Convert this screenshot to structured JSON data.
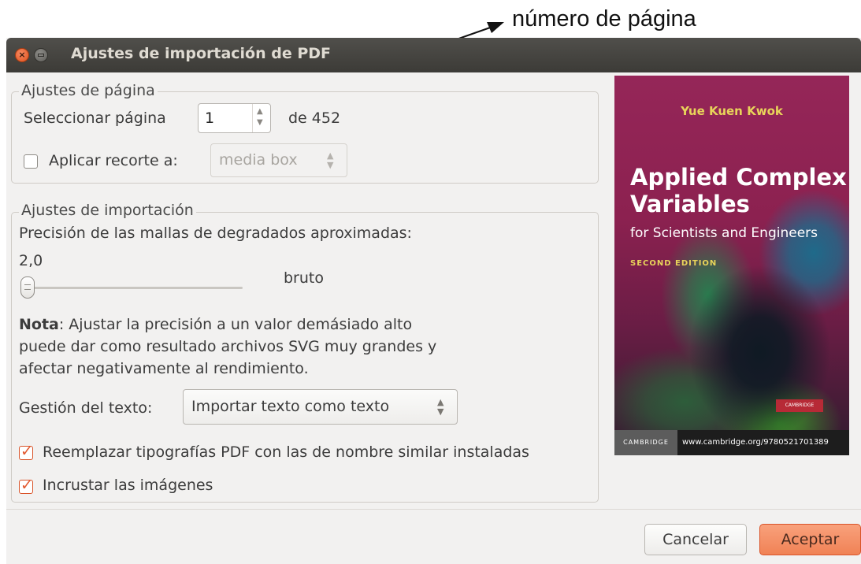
{
  "annotation": {
    "label": "número de página"
  },
  "window": {
    "title": "Ajustes de importación de PDF",
    "close_glyph": "×"
  },
  "page_settings": {
    "legend": "Ajustes de página",
    "select_page_label": "Seleccionar página",
    "page_value": "1",
    "page_of": "de 452",
    "crop_checkbox_checked": false,
    "crop_label": "Aplicar recorte a:",
    "crop_option": "media box"
  },
  "import_settings": {
    "legend": "Ajustes de importación",
    "precision_label": "Precisión de las mallas de degradados aproximadas:",
    "precision_value": "2,0",
    "precision_level_text": "bruto",
    "note_bold": "Nota",
    "note_text": ": Ajustar la precisión a un valor demásiado alto puede dar como resultado archivos SVG muy grandes y afectar negativamente al rendimiento.",
    "text_handling_label": "Gestión del texto:",
    "text_handling_option": "Importar texto como texto",
    "replace_fonts_checked": true,
    "replace_fonts_label": "Reemplazar tipografías PDF con las de nombre similar instaladas",
    "embed_images_checked": true,
    "embed_images_label": "Incrustar las imágenes"
  },
  "preview": {
    "author": "Yue Kuen Kwok",
    "title_line1": "Applied Complex",
    "title_line2": "Variables",
    "subtitle": "for Scientists and Engineers",
    "edition": "SECOND EDITION",
    "publisher_badge": "CAMBRIDGE",
    "bar_publisher": "CAMBRIDGE",
    "bar_url": "www.cambridge.org/9780521701389"
  },
  "buttons": {
    "cancel": "Cancelar",
    "accept": "Aceptar"
  },
  "colors": {
    "accent": "#f08255",
    "titlebar": "#3c3b37",
    "check": "#e2582e"
  }
}
